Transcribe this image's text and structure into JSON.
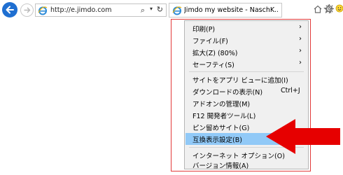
{
  "toolbar": {
    "url": "http://e.jimdo.com",
    "search_symbol": "⌕",
    "dropdown_symbol": "▾",
    "refresh_symbol": "↻"
  },
  "tab": {
    "title": "Jimdo my website - NaschK..."
  },
  "menu": {
    "items": [
      {
        "label": "印刷(P)",
        "arrow": "›"
      },
      {
        "label": "ファイル(F)",
        "arrow": "›"
      },
      {
        "label": "拡大(Z) (80%)",
        "arrow": "›"
      },
      {
        "label": "セーフティ(S)",
        "arrow": "›"
      },
      {
        "label": "サイトをアプリ ビューに追加(I)"
      },
      {
        "label": "ダウンロードの表示(N)",
        "shortcut": "Ctrl+J"
      },
      {
        "label": "アドオンの管理(M)"
      },
      {
        "label": "F12 開発者ツール(L)"
      },
      {
        "label": "ピン留めサイト(G)"
      },
      {
        "label": "互換表示設定(B)"
      },
      {
        "label": "インターネット オプション(O)"
      },
      {
        "label": "バージョン情報(A)"
      }
    ]
  },
  "colors": {
    "highlight": "#91c9f7",
    "annotation_red": "#e60000",
    "accent_blue": "#1f6fd1"
  }
}
